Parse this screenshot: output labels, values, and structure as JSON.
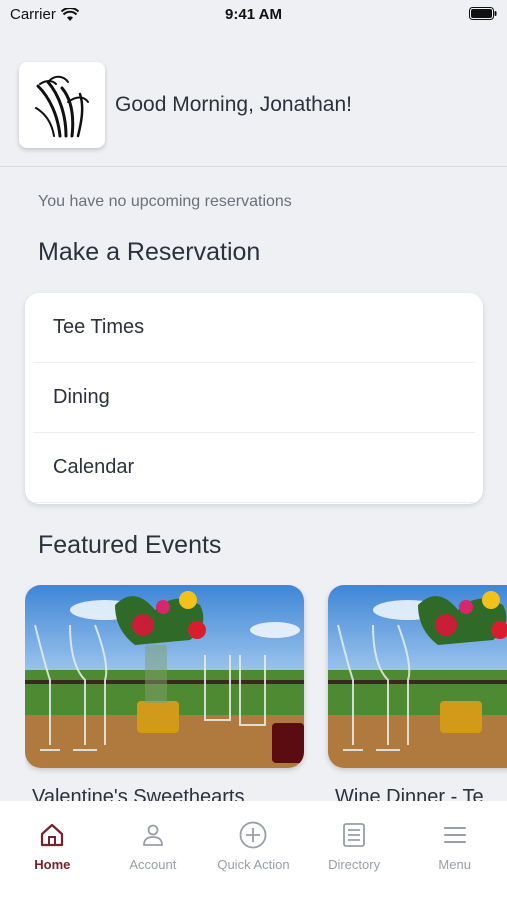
{
  "status_bar": {
    "carrier": "Carrier",
    "time": "9:41 AM"
  },
  "header": {
    "greeting": "Good Morning, Jonathan!"
  },
  "reservations": {
    "empty_message": "You have no upcoming reservations"
  },
  "make_reservation": {
    "title": "Make a Reservation",
    "items": [
      {
        "label": "Tee Times"
      },
      {
        "label": "Dining"
      },
      {
        "label": "Calendar"
      }
    ]
  },
  "featured_events": {
    "title": "Featured Events",
    "events": [
      {
        "title": "Valentine's Sweethearts"
      },
      {
        "title": "Wine Dinner - Te"
      }
    ]
  },
  "tab_bar": {
    "active_color": "#7a1f2b",
    "tabs": [
      {
        "label": "Home",
        "icon": "home-icon",
        "active": true
      },
      {
        "label": "Account",
        "icon": "person-icon",
        "active": false
      },
      {
        "label": "Quick Action",
        "icon": "plus-circle-icon",
        "active": false
      },
      {
        "label": "Directory",
        "icon": "directory-icon",
        "active": false
      },
      {
        "label": "Menu",
        "icon": "menu-icon",
        "active": false
      }
    ]
  }
}
